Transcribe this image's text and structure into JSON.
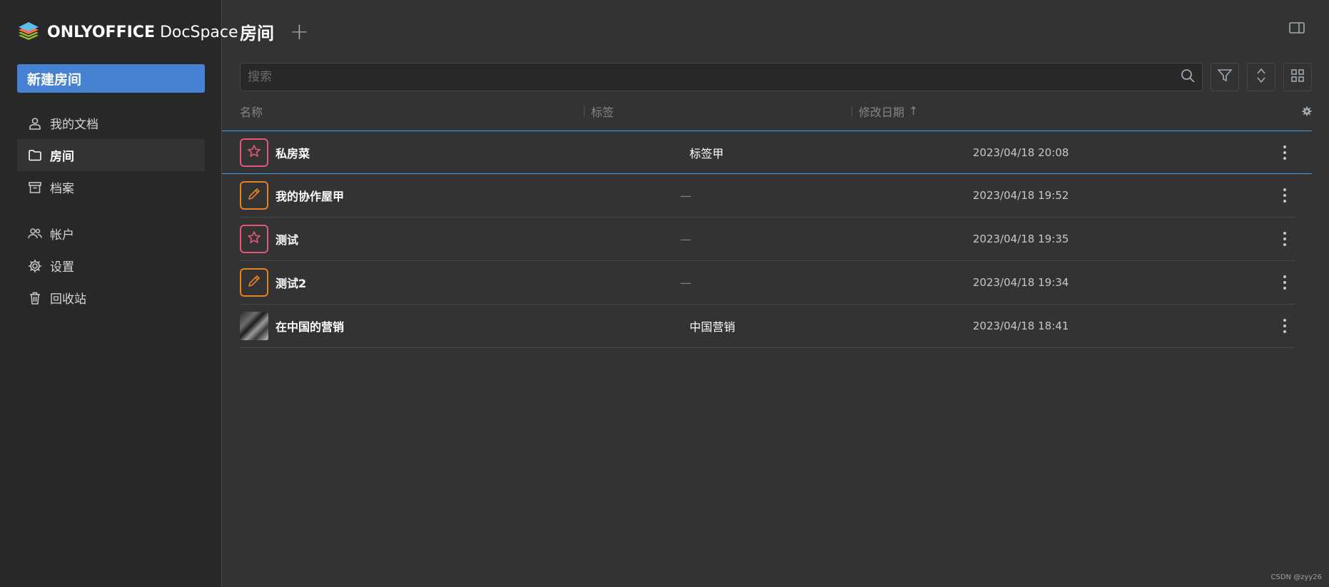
{
  "brand": {
    "name_bold": "ONLYOFFICE",
    "name_light": " DocSpace"
  },
  "sidebar": {
    "new_room_label": "新建房间",
    "items": [
      {
        "label": "我的文档",
        "icon": "user-icon"
      },
      {
        "label": "房间",
        "icon": "folder-icon",
        "active": true
      },
      {
        "label": "档案",
        "icon": "archive-icon"
      },
      {
        "label": "帐户",
        "icon": "accounts-icon"
      },
      {
        "label": "设置",
        "icon": "gear-icon"
      },
      {
        "label": "回收站",
        "icon": "trash-icon"
      }
    ]
  },
  "header": {
    "title": "房间",
    "add_label": "+"
  },
  "search": {
    "placeholder": "搜索"
  },
  "table": {
    "columns": {
      "name": "名称",
      "tags": "标签",
      "modified": "修改日期",
      "sort_arrow": "↑"
    },
    "rows": [
      {
        "name": "私房菜",
        "tag": "标签甲",
        "date": "2023/04/18 20:08",
        "icon": "star-icon",
        "selected": true
      },
      {
        "name": "我的协作屋甲",
        "tag": "—",
        "date": "2023/04/18 19:52",
        "icon": "pencil-icon"
      },
      {
        "name": "测试",
        "tag": "—",
        "date": "2023/04/18 19:35",
        "icon": "star-icon"
      },
      {
        "name": "测试2",
        "tag": "—",
        "date": "2023/04/18 19:34",
        "icon": "pencil-icon"
      },
      {
        "name": "在中国的营销",
        "tag": "中国营销",
        "date": "2023/04/18 18:41",
        "icon": "photo-thumbnail"
      }
    ]
  },
  "watermark": "CSDN @zyy26",
  "colors": {
    "accent": "#4781d1",
    "star_room": "#e4557c",
    "edit_room": "#e5811e",
    "selection": "#4a9bdc"
  }
}
